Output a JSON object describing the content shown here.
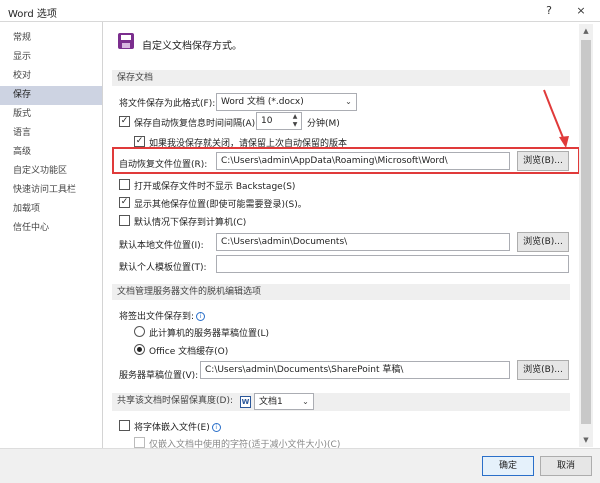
{
  "window": {
    "title": "Word 选项",
    "help": "?",
    "close": "×"
  },
  "sidebar": {
    "items": [
      {
        "label": "常规"
      },
      {
        "label": "显示"
      },
      {
        "label": "校对"
      },
      {
        "label": "保存"
      },
      {
        "label": "版式"
      },
      {
        "label": "语言"
      },
      {
        "label": "高级"
      },
      {
        "label": "自定义功能区"
      },
      {
        "label": "快速访问工具栏"
      },
      {
        "label": "加载项"
      },
      {
        "label": "信任中心"
      }
    ],
    "selected": "保存"
  },
  "header": {
    "text": "自定义文档保存方式。"
  },
  "save_docs": {
    "title": "保存文档",
    "format_label": "将文件保存为此格式(F):",
    "format_value": "Word 文档 (*.docx)",
    "autorecover_label": "保存自动恢复信息时间间隔(A)",
    "autorecover_checked": true,
    "autorecover_minutes": "10",
    "minutes_label": "分钟(M)",
    "keep_last_label": "如果我没保存就关闭，请保留上次自动保留的版本",
    "keep_last_checked": true,
    "autorecover_path_label": "自动恢复文件位置(R):",
    "autorecover_path": "C:\\Users\\admin\\AppData\\Roaming\\Microsoft\\Word\\",
    "browse1": "浏览(B)...",
    "no_backstage_label": "打开或保存文件时不显示 Backstage(S)",
    "no_backstage_checked": false,
    "show_other_label": "显示其他保存位置(即使可能需要登录)(S)。",
    "show_other_checked": true,
    "default_computer_label": "默认情况下保存到计算机(C)",
    "default_computer_checked": false,
    "local_path_label": "默认本地文件位置(I):",
    "local_path": "C:\\Users\\admin\\Documents\\",
    "browse2": "浏览(B)...",
    "template_label": "默认个人模板位置(T):",
    "template_path": ""
  },
  "offline": {
    "title": "文档管理服务器文件的脱机编辑选项",
    "checkout_label": "将签出文件保存到:",
    "option_server": "此计算机的服务器草稿位置(L)",
    "option_cache": "Office 文档缓存(O)",
    "selected": "Office 文档缓存(O)",
    "drafts_label": "服务器草稿位置(V):",
    "drafts_path": "C:\\Users\\admin\\Documents\\SharePoint 草稿\\",
    "browse3": "浏览(B)..."
  },
  "share": {
    "title_label": "共享该文档时保留保真度(D):",
    "doc_value": "文档1",
    "embed_fonts_label": "将字体嵌入文件(E)",
    "embed_fonts_checked": false,
    "embed_used_label": "仅嵌入文档中使用的字符(适于减小文件大小)(C)",
    "embed_used_checked": false
  },
  "footer": {
    "ok": "确定",
    "cancel": "取消"
  },
  "colors": {
    "highlight": "#e03a3a",
    "selected_nav": "#cdd3e2",
    "accent": "#7b2e8e"
  },
  "icons": [
    "save-icon",
    "info-icon",
    "word-doc-icon",
    "chevron-down-icon",
    "red-arrow-icon"
  ]
}
